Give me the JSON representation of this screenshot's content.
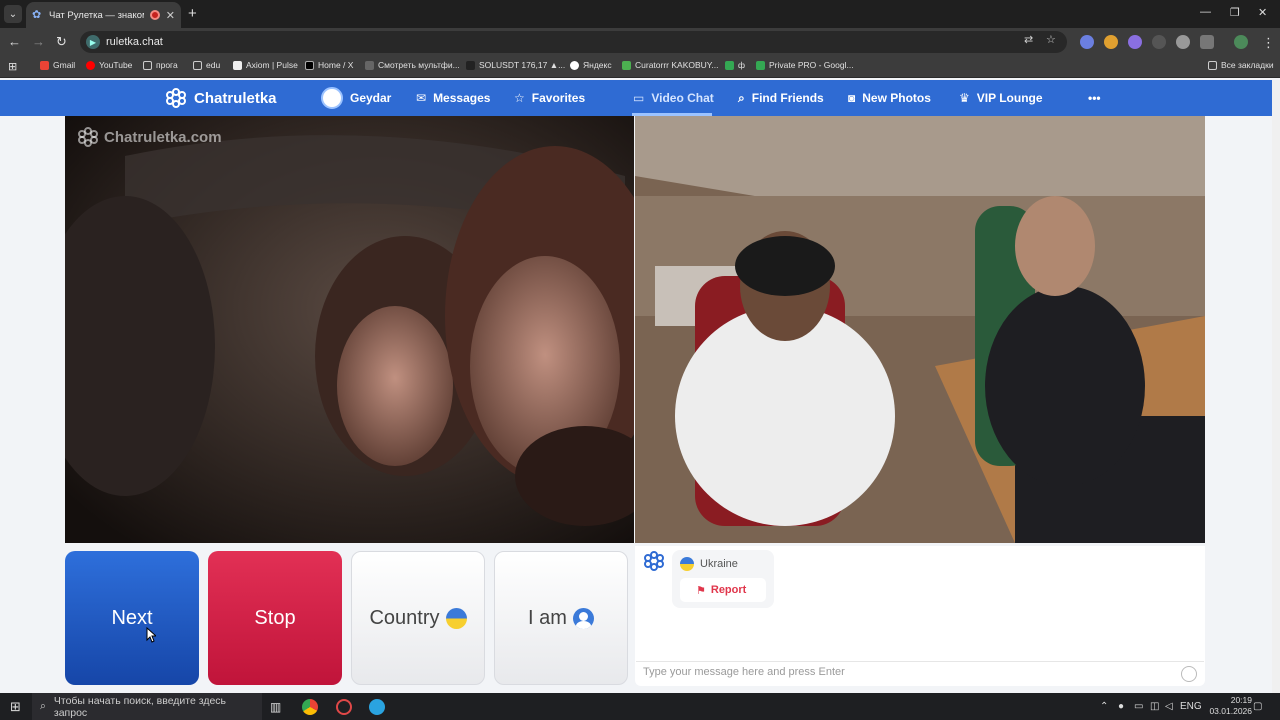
{
  "browser": {
    "tab_title": "Чат Рулетка — знакомства",
    "url": "ruletka.chat",
    "bookmarks": [
      "Gmail",
      "YouTube",
      "прога",
      "edu",
      "Axiom | Pulse",
      "Home / X",
      "Смотреть мультфи...",
      "SOLUSDT 176,17 ▲...",
      "Яндекс",
      "Curatorrr KAKOBUY...",
      "ф",
      "Private PRO - Googl..."
    ],
    "all_bookmarks": "Все закладки"
  },
  "site": {
    "brand": "Chatruletka",
    "watermark": "Chatruletka.com",
    "nav": {
      "user": "Geydar",
      "messages": "Messages",
      "favorites": "Favorites",
      "video_chat": "Video Chat",
      "find_friends": "Find Friends",
      "new_photos": "New Photos",
      "vip": "VIP Lounge",
      "more": "•••"
    },
    "accent_color": "#2f6bd3"
  },
  "controls": {
    "next": "Next",
    "stop": "Stop",
    "country": "Country",
    "iam": "I am"
  },
  "chat": {
    "country": "Ukraine",
    "report": "Report",
    "placeholder": "Type your message here and press Enter"
  },
  "taskbar": {
    "search_placeholder": "Чтобы начать поиск, введите здесь запрос",
    "lang": "ENG",
    "time": "20:19",
    "date": "03.01.2026"
  }
}
